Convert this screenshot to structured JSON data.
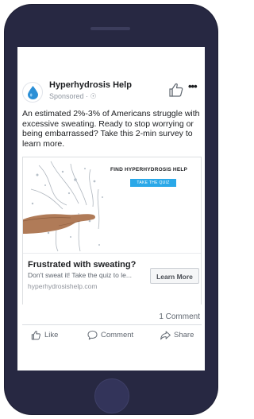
{
  "post": {
    "page_name": "Hyperhydrosis Help",
    "sponsored": "Sponsored · ☉",
    "text": "An estimated 2%-3% of Americans struggle with excessive sweating. Ready to stop worrying or being embarrassed? Take this 2-min survey to learn more."
  },
  "ad": {
    "image_headline": "FIND HYPERHYDROSIS HELP",
    "image_button": "TAKE THE QUIZ",
    "title": "Frustrated with sweating?",
    "description": "Don't sweat it! Take the quiz to le...",
    "url": "hyperhydrosishelp.com",
    "cta": "Learn More"
  },
  "engagement": {
    "comments": "1 Comment"
  },
  "actions": {
    "like": "Like",
    "comment": "Comment",
    "share": "Share"
  },
  "icons": {
    "avatar": "water-drop-icon",
    "like_page": "thumbs-up-icon",
    "more": "more-dots-icon",
    "like": "thumbs-up-icon",
    "comment": "speech-bubble-icon",
    "share": "share-arrow-icon"
  },
  "colors": {
    "phone_frame": "#272842",
    "brand_drop": "#2b8fd6",
    "quiz_button": "#2aa8e8",
    "text": "#1c1e21",
    "muted": "#606770"
  }
}
